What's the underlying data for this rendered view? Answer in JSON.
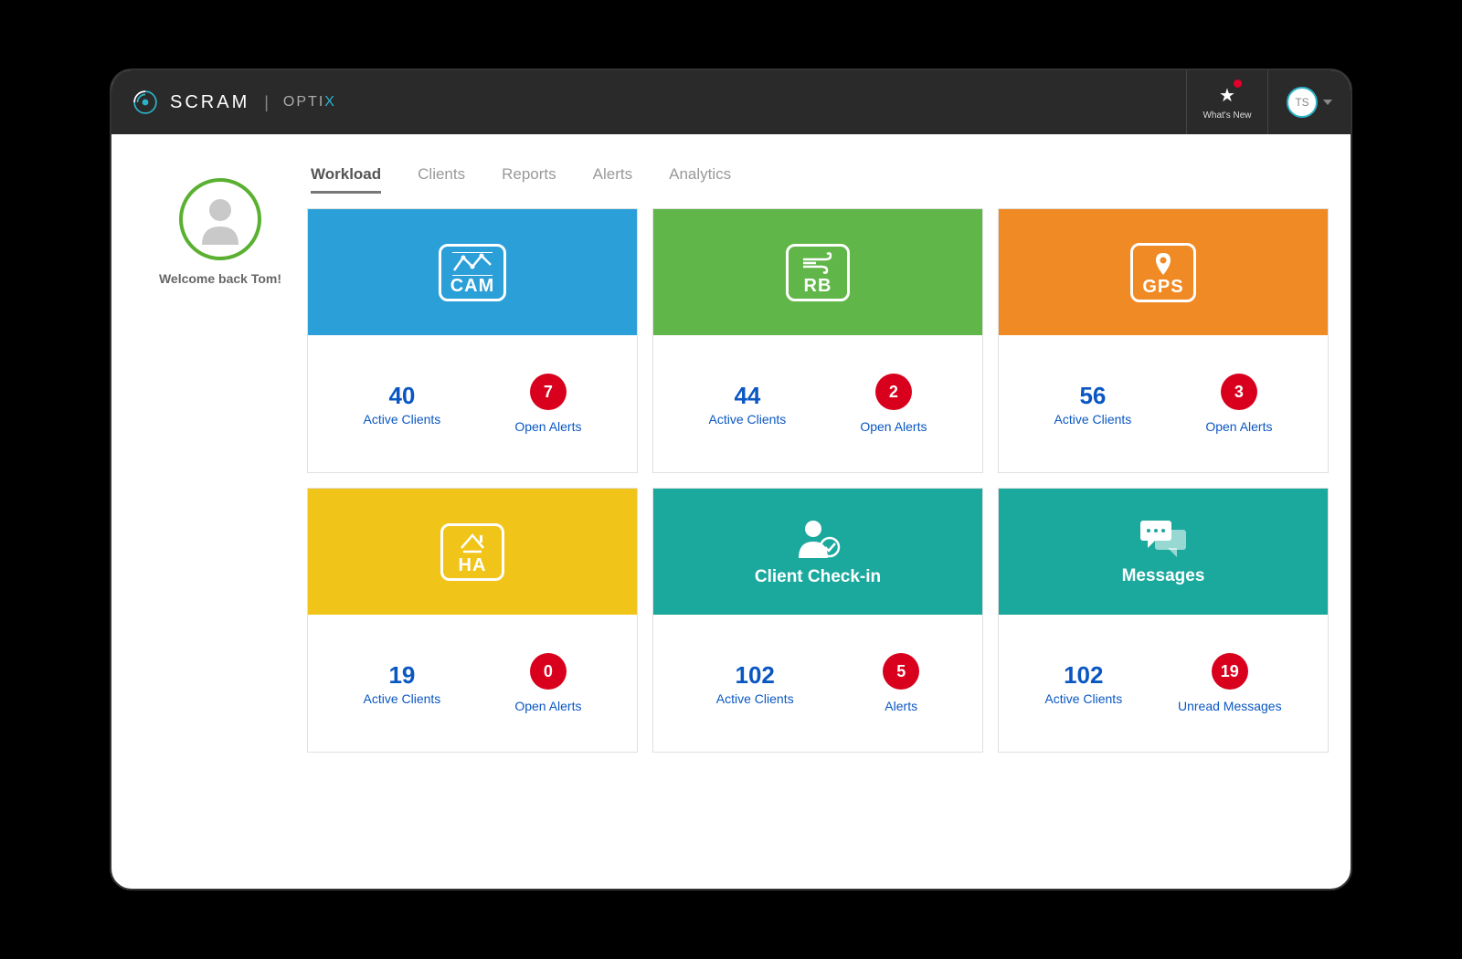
{
  "header": {
    "brand_primary": "SCRAM",
    "brand_secondary": "OPTI",
    "whats_new_label": "What's New",
    "user_initials": "TS"
  },
  "sidebar": {
    "welcome_text": "Welcome back Tom!"
  },
  "tabs": [
    {
      "label": "Workload",
      "active": true
    },
    {
      "label": "Clients",
      "active": false
    },
    {
      "label": "Reports",
      "active": false
    },
    {
      "label": "Alerts",
      "active": false
    },
    {
      "label": "Analytics",
      "active": false
    }
  ],
  "cards": [
    {
      "icon_label": "CAM",
      "color": "blue",
      "active_count": "40",
      "active_label": "Active Clients",
      "alert_count": "7",
      "alert_label": "Open Alerts",
      "title": ""
    },
    {
      "icon_label": "RB",
      "color": "green",
      "active_count": "44",
      "active_label": "Active Clients",
      "alert_count": "2",
      "alert_label": "Open Alerts",
      "title": ""
    },
    {
      "icon_label": "GPS",
      "color": "orange",
      "active_count": "56",
      "active_label": "Active Clients",
      "alert_count": "3",
      "alert_label": "Open Alerts",
      "title": ""
    },
    {
      "icon_label": "HA",
      "color": "yellow",
      "active_count": "19",
      "active_label": "Active Clients",
      "alert_count": "0",
      "alert_label": "Open Alerts",
      "title": ""
    },
    {
      "icon_label": "",
      "color": "teal",
      "active_count": "102",
      "active_label": "Active Clients",
      "alert_count": "5",
      "alert_label": "Alerts",
      "title": "Client Check-in"
    },
    {
      "icon_label": "",
      "color": "teal",
      "active_count": "102",
      "active_label": "Active Clients",
      "alert_count": "19",
      "alert_label": "Unread Messages",
      "title": "Messages"
    }
  ]
}
